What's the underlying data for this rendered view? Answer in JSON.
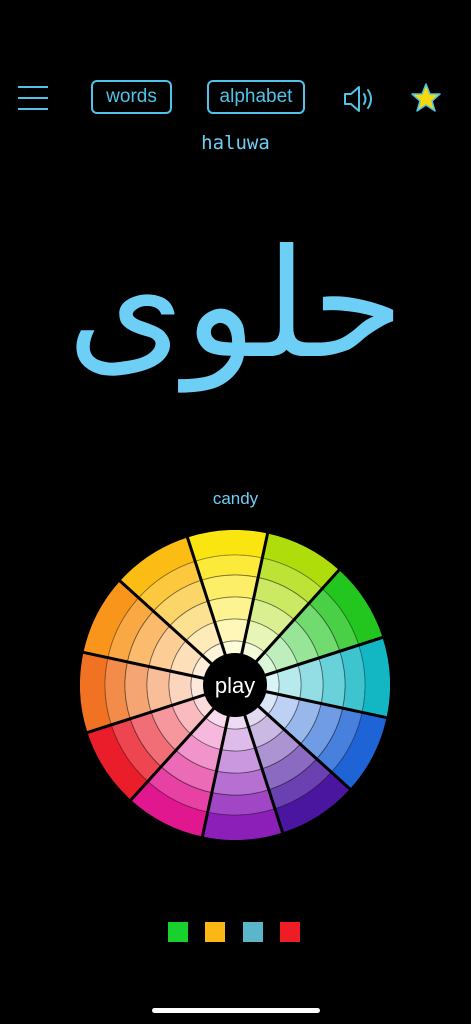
{
  "header": {
    "menu_icon": "hamburger-menu-icon",
    "words_label": "words",
    "alphabet_label": "alphabet",
    "sound_icon": "speaker-volume-icon",
    "favorite_icon": "star-icon",
    "accent_color": "#4fc3e8",
    "star_color": "#f5d90a"
  },
  "word": {
    "transliteration": "haluwa",
    "arabic": "حلوى",
    "meaning": "candy",
    "color": "#6ecff6"
  },
  "wheel": {
    "center_label": "play",
    "segment_colors": [
      "#fbe510",
      "#aedd0b",
      "#22c61f",
      "#13b7c4",
      "#1f64d6",
      "#4a16a0",
      "#8c1fb8",
      "#e0178f",
      "#ea1d2a",
      "#f07222",
      "#f8951a",
      "#fbbd14"
    ]
  },
  "selected_colors": [
    "#19d12c",
    "#fbb814",
    "#5ab6c9",
    "#ee1c25"
  ]
}
